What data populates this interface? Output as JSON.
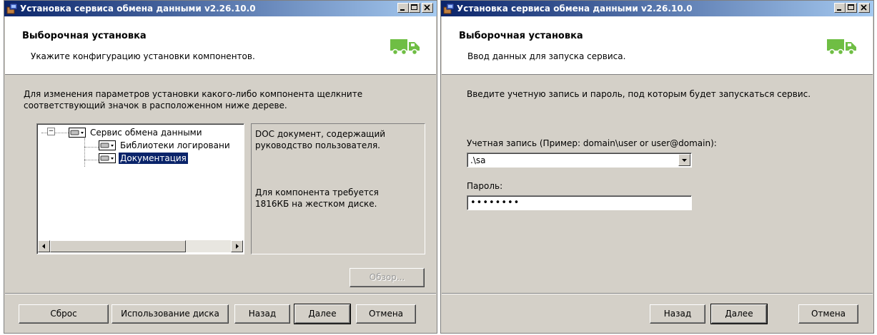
{
  "window1": {
    "title": "Установка сервиса обмена данными v2.26.10.0",
    "header_title": "Выборочная установка",
    "header_subtitle": "Укажите конфигурацию установки компонентов.",
    "instruction_line1": "Для изменения параметров установки какого-либо компонента щелкните",
    "instruction_line2": "соответствующий значок в расположенном ниже дереве.",
    "tree": {
      "expander": "−",
      "root": "Сервис обмена данными",
      "children": [
        "Библиотеки логировани",
        "Документация"
      ],
      "selected": "Документация"
    },
    "description": {
      "line1": "DOC документ, содержащий",
      "line2": "руководство пользователя.",
      "req_line1": "Для компонента требуется",
      "req_line2": "1816КБ на жестком диске."
    },
    "browse_button": "Обзор...",
    "buttons": {
      "reset": "Сброс",
      "disk_usage": "Использование диска",
      "back": "Назад",
      "next": "Далее",
      "cancel": "Отмена"
    }
  },
  "window2": {
    "title": "Установка сервиса обмена данными v2.26.10.0",
    "header_title": "Выборочная установка",
    "header_subtitle": "Ввод данных для запуска сервиса.",
    "instruction": "Введите учетную запись и пароль, под которым будет запускаться сервис.",
    "account_label": "Учетная запись (Пример: domain\\user or user@domain):",
    "account_value": ".\\sa",
    "password_label": "Пароль:",
    "password_value": "••••••••",
    "buttons": {
      "back": "Назад",
      "next": "Далее",
      "cancel": "Отмена"
    }
  },
  "colors": {
    "titlebar_start": "#0a246a",
    "titlebar_end": "#a6caf0",
    "face": "#d4d0c8",
    "truck": "#6fbe44"
  },
  "icons": [
    "installer-icon",
    "minimize-icon",
    "maximize-icon",
    "close-icon",
    "truck-icon",
    "drive-icon",
    "dropdown-arrow-icon",
    "scroll-left-icon",
    "scroll-right-icon"
  ]
}
